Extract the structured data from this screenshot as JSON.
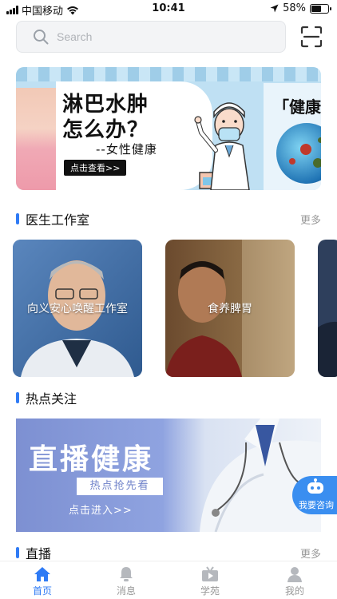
{
  "status_bar": {
    "carrier": "中国移动",
    "time": "10:41",
    "battery_text": "58%",
    "battery_level": 0.58
  },
  "search": {
    "placeholder": "Search"
  },
  "banner": {
    "title_line1": "淋巴水肿",
    "title_line2": "怎么办？",
    "subtitle": "--女性健康",
    "cta": "点击查看>>",
    "panel_title": "「健康"
  },
  "doctor_section": {
    "title": "医生工作室",
    "more": "更多",
    "cards": [
      {
        "label": "向义安心唤醒工作室"
      },
      {
        "label": "食养脾胃"
      }
    ]
  },
  "hot_section": {
    "title": "热点关注"
  },
  "live_banner": {
    "title": "直播健康",
    "pill": "热点抢先看",
    "enter": "点击进入>>"
  },
  "consult": {
    "label": "我要咨询"
  },
  "live_section": {
    "title": "直播",
    "more": "更多"
  },
  "tabs": [
    {
      "label": "首页",
      "icon": "home-icon",
      "active": true
    },
    {
      "label": "消息",
      "icon": "bell-icon",
      "active": false
    },
    {
      "label": "学苑",
      "icon": "tv-icon",
      "active": false
    },
    {
      "label": "我的",
      "icon": "person-icon",
      "active": false
    }
  ],
  "colors": {
    "accent": "#2f7bf5",
    "tab_inactive": "#999999"
  }
}
